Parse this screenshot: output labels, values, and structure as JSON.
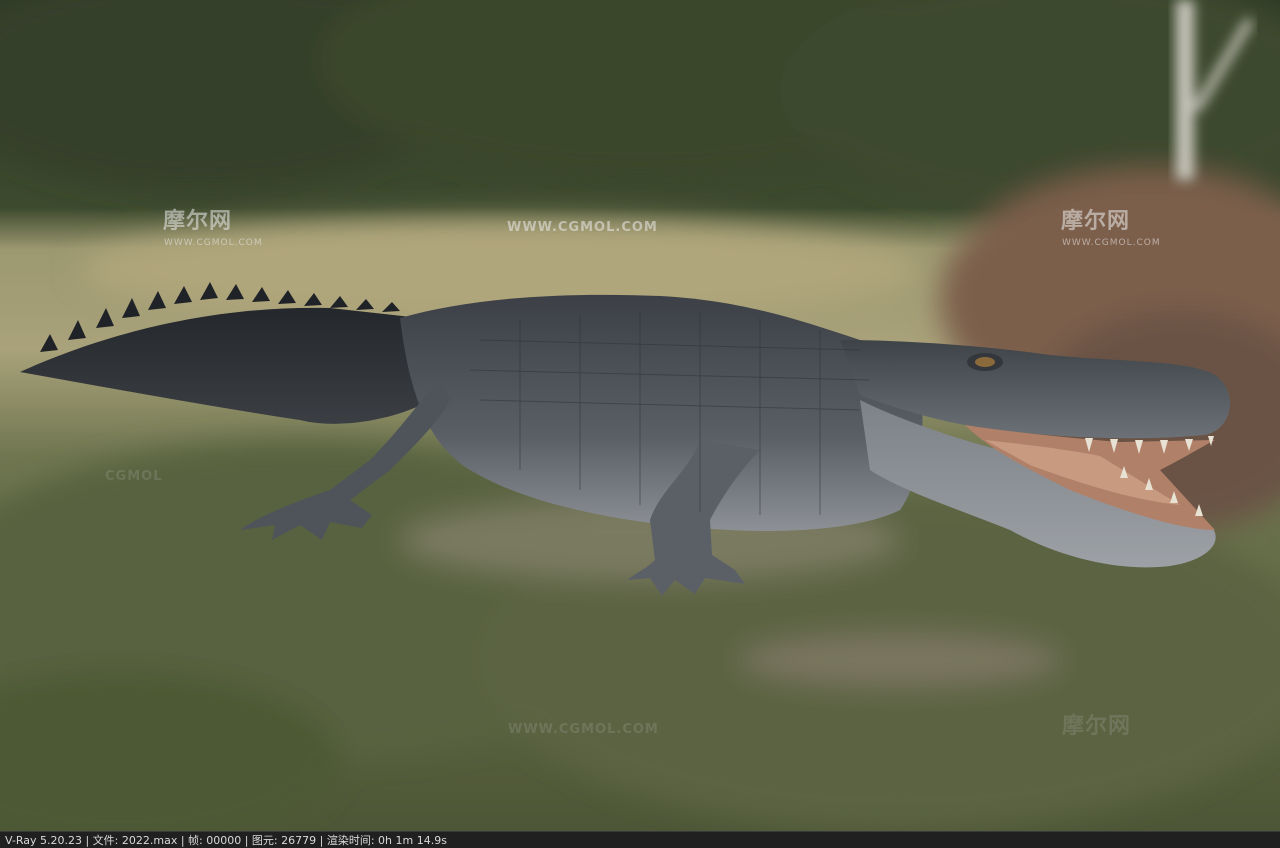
{
  "render": {
    "subject_icon": "alligator-render",
    "colors": {
      "background_green": "#4e5a3a",
      "statusbar_bg": "#202020",
      "statusbar_text": "#d8d8d8"
    }
  },
  "watermarks": {
    "brand_cn": "摩尔网",
    "brand_url_small": "WWW.CGMOL.COM",
    "url": "WWW.CGMOL.COM",
    "short": "CGMOL"
  },
  "statusbar": {
    "text": "V-Ray 5.20.23 | 文件: 2022.max | 帧: 00000 | 图元: 26779 | 渲染时间: 0h  1m 14.9s"
  }
}
